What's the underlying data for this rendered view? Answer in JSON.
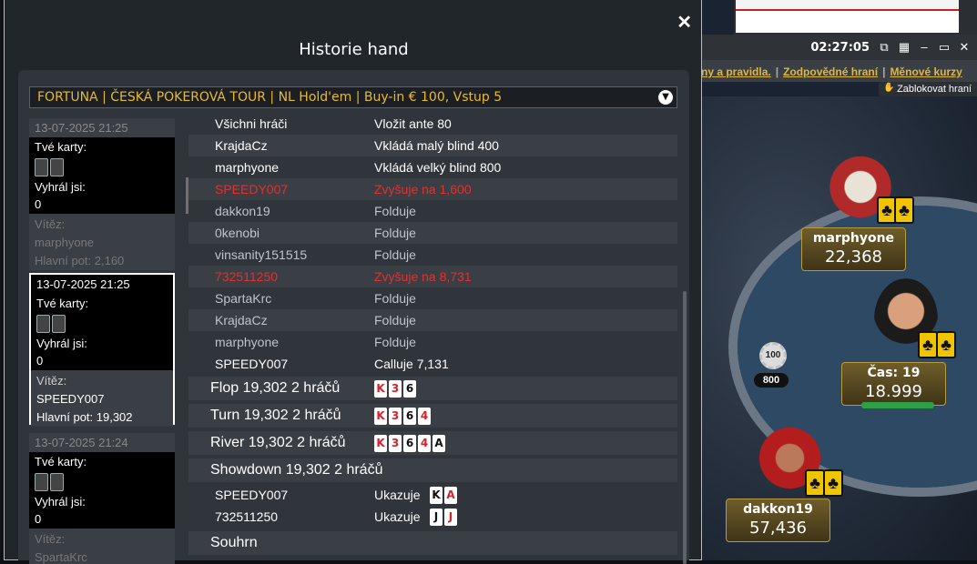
{
  "table": {
    "clock": "02:27:05",
    "links": [
      "ny a pravidla.",
      "Zodpovědné hraní",
      "Měnové kurzy"
    ],
    "block_label": "Zablokovat hraní",
    "players": [
      {
        "name": "marphyone",
        "stack": "22,368"
      },
      {
        "name": "Čas: 19",
        "stack": "18.999"
      },
      {
        "name": "dakkon19",
        "stack": "57,436"
      }
    ],
    "pot_chip_label": "100",
    "pot_amount": "800"
  },
  "modal": {
    "title": "Historie hand",
    "close": "✕",
    "tournament_select": "FORTUNA | ČESKÁ POKEROVÁ TOUR | NL Hold'em | Buy-in € 100, Vstup 5"
  },
  "hands": [
    {
      "datetime": "13-07-2025 21:25",
      "cards_label": "Tvé karty:",
      "won_label": "Vyhrál jsi:",
      "won": "0",
      "winner_label": "Vítěz:",
      "winner": "marphyone",
      "pot": "Hlavní pot: 2,160"
    },
    {
      "datetime": "13-07-2025 21:25",
      "cards_label": "Tvé karty:",
      "won_label": "Vyhrál jsi:",
      "won": "0",
      "winner_label": "Vítěz:",
      "winner": "SPEEDY007",
      "pot": "Hlavní pot: 19,302"
    },
    {
      "datetime": "13-07-2025 21:24",
      "cards_label": "Tvé karty:",
      "won_label": "Vyhrál jsi:",
      "won": "0",
      "winner_label": "Vítěz:",
      "winner": "SpartaKrc",
      "pot": ""
    }
  ],
  "actions": [
    {
      "player": "Všichni hráči",
      "action": "Vložit ante 80"
    },
    {
      "player": "KrajdaCz",
      "action": "Vkládá malý blind 400"
    },
    {
      "player": "marphyone",
      "action": "Vkládá velký blind 800"
    },
    {
      "player": "SPEEDY007",
      "action": "Zvyšuje na 1,600"
    },
    {
      "player": "dakkon19",
      "action": "Folduje"
    },
    {
      "player": "0kenobi",
      "action": "Folduje"
    },
    {
      "player": "vinsanity151515",
      "action": "Folduje"
    },
    {
      "player": "732511250",
      "action": "Zvyšuje na 8,731"
    },
    {
      "player": "SpartaKrc",
      "action": "Folduje"
    },
    {
      "player": "KrajdaCz",
      "action": "Folduje"
    },
    {
      "player": "marphyone",
      "action": "Folduje"
    },
    {
      "player": "SPEEDY007",
      "action": "Calluje 7,131"
    }
  ],
  "streets": [
    {
      "label": "Flop  19,302  2 hráčů"
    },
    {
      "label": "Turn  19,302  2 hráčů"
    },
    {
      "label": "River  19,302  2 hráčů"
    }
  ],
  "showdown": {
    "label": "Showdown  19,302  2 hráčů",
    "rows": [
      {
        "player": "SPEEDY007",
        "action": "Ukazuje"
      },
      {
        "player": "732511250",
        "action": "Ukazuje"
      }
    ]
  },
  "summary_label": "Souhrn",
  "cards": {
    "flop": [
      "K",
      "3",
      "6"
    ],
    "turn": [
      "K",
      "3",
      "6",
      "4"
    ],
    "river": [
      "K",
      "3",
      "6",
      "4",
      "A"
    ],
    "show1": [
      "K",
      "A"
    ],
    "show2": [
      "J",
      "J"
    ]
  }
}
